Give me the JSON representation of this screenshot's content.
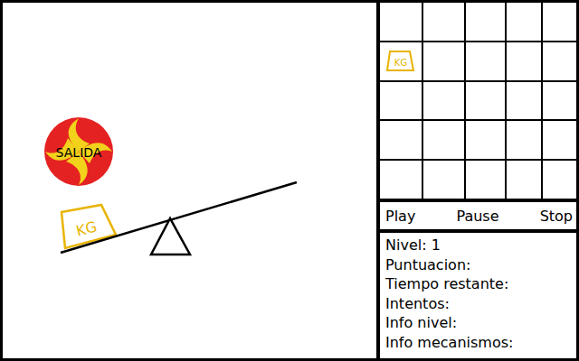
{
  "canvas": {
    "exit": {
      "label": "SALIDA"
    },
    "weight": {
      "label": "KG"
    }
  },
  "toolbox": {
    "rows": [
      [
        {
          "kind": "empty",
          "label": ""
        },
        {
          "kind": "empty",
          "label": ""
        },
        {
          "kind": "empty",
          "label": ""
        },
        {
          "kind": "empty",
          "label": ""
        },
        {
          "kind": "empty",
          "label": ""
        }
      ],
      [
        {
          "kind": "weight",
          "label": "KG"
        },
        {
          "kind": "empty",
          "label": ""
        },
        {
          "kind": "empty",
          "label": ""
        },
        {
          "kind": "empty",
          "label": ""
        },
        {
          "kind": "empty",
          "label": ""
        }
      ],
      [
        {
          "kind": "empty",
          "label": ""
        },
        {
          "kind": "empty",
          "label": ""
        },
        {
          "kind": "empty",
          "label": ""
        },
        {
          "kind": "empty",
          "label": ""
        },
        {
          "kind": "empty",
          "label": ""
        }
      ],
      [
        {
          "kind": "empty",
          "label": ""
        },
        {
          "kind": "empty",
          "label": ""
        },
        {
          "kind": "empty",
          "label": ""
        },
        {
          "kind": "empty",
          "label": ""
        },
        {
          "kind": "empty",
          "label": ""
        }
      ],
      [
        {
          "kind": "empty",
          "label": ""
        },
        {
          "kind": "empty",
          "label": ""
        },
        {
          "kind": "empty",
          "label": ""
        },
        {
          "kind": "empty",
          "label": ""
        },
        {
          "kind": "empty",
          "label": ""
        }
      ]
    ]
  },
  "controls": [
    "Play",
    "Pause",
    "Stop"
  ],
  "info": [
    "Nivel: 1",
    "Puntuacion:",
    "Tiempo restante:",
    "Intentos:",
    "Info nivel:",
    "Info mecanismos:"
  ]
}
